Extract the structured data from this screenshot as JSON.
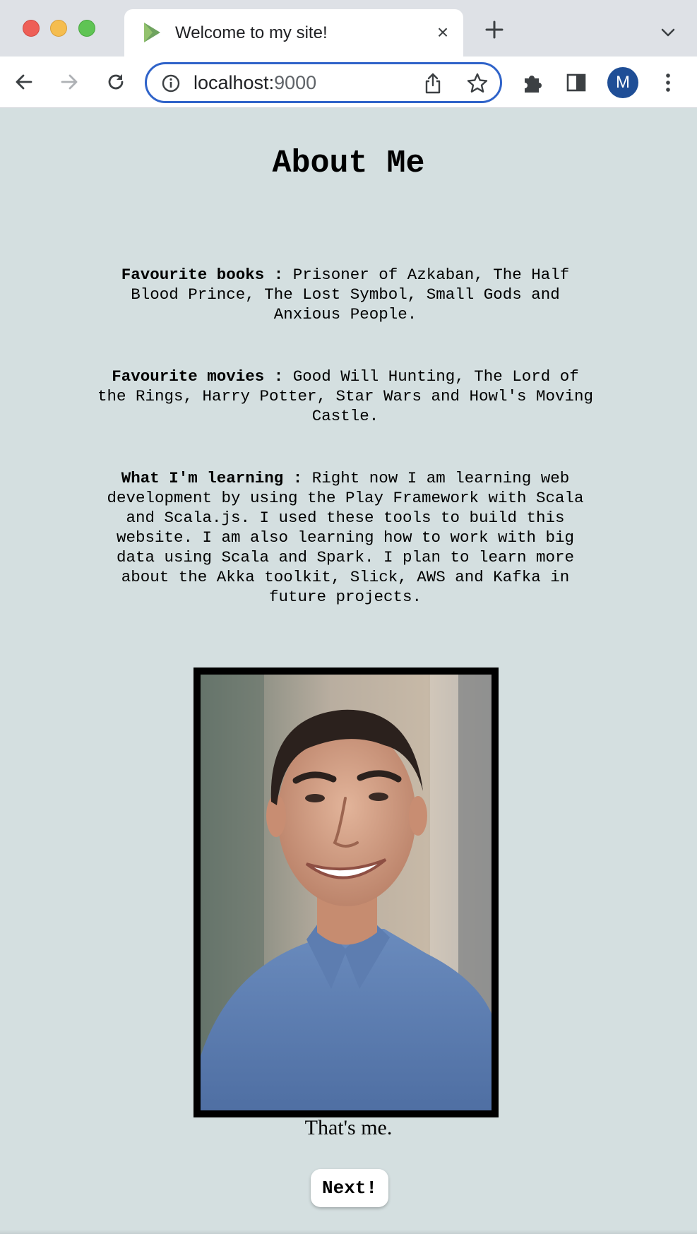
{
  "browser": {
    "tab_title": "Welcome to my site!",
    "url_host": "localhost:",
    "url_port": "9000",
    "profile_initial": "M"
  },
  "page": {
    "heading": "About Me",
    "books_label": "Favourite books :",
    "books_text": " Prisoner of Azkaban, The Half Blood Prince, The Lost Symbol, Small Gods and Anxious People.",
    "movies_label": "Favourite movies :",
    "movies_text": " Good Will Hunting, The Lord of the Rings, Harry Potter, Star Wars and Howl's Moving Castle.",
    "learning_label": "What I'm learning :",
    "learning_text": " Right now I am learning web development by using the Play Framework with Scala and Scala.js. I used these tools to build this website. I am also learning how to work with big data using Scala and Spark. I plan to learn more about the Akka toolkit, Slick, AWS and Kafka in future projects.",
    "caption": "That's me.",
    "next_label": "Next!"
  },
  "colors": {
    "page_background": "#d4dfe0",
    "omnibox_focus": "#2f63c9",
    "avatar": "#1f4e96"
  }
}
